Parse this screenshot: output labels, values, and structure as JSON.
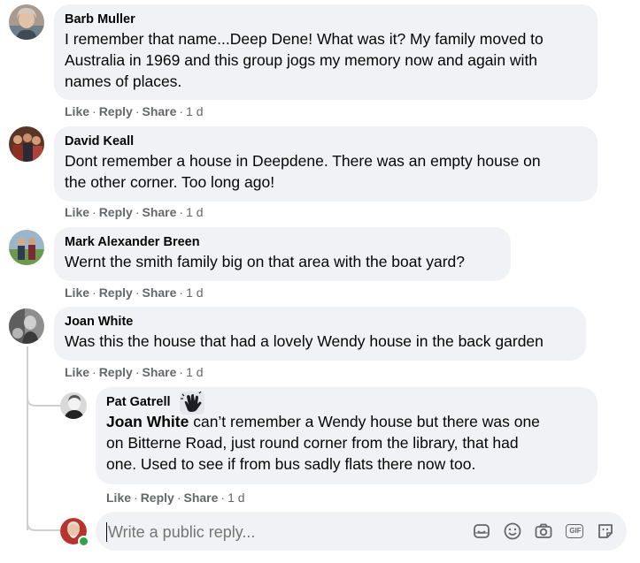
{
  "comments": [
    {
      "author": "Barb Muller",
      "lines": [
        "I remember that name...Deep Dene! What was it? My family moved to",
        "Australia in 1969 and this group jogs my memory now and again with",
        "names of places."
      ],
      "actions": {
        "like": "Like",
        "reply": "Reply",
        "share": "Share",
        "time": "1 d"
      }
    },
    {
      "author": "David Keall",
      "lines": [
        "Dont remember a house in Deepdene. There was an empty house on",
        "the other corner. Too long ago!"
      ],
      "actions": {
        "like": "Like",
        "reply": "Reply",
        "share": "Share",
        "time": "1 d"
      }
    },
    {
      "author": "Mark Alexander Breen",
      "lines": [
        "Wernt the smith family big on that area with the boat yard?"
      ],
      "actions": {
        "like": "Like",
        "reply": "Reply",
        "share": "Share",
        "time": "1 d"
      }
    },
    {
      "author": "Joan White",
      "lines": [
        "Was this the house that had a lovely Wendy house in the back garden"
      ],
      "actions": {
        "like": "Like",
        "reply": "Reply",
        "share": "Share",
        "time": "1 d"
      }
    }
  ],
  "reply": {
    "author": "Pat Gatrell",
    "mention": "Joan White",
    "first_line_rest": " can’t remember a Wendy house but there was one",
    "lines": [
      "on Bitterne Road, just round corner from the library, that had",
      "one. Used to see if from bus sadly flats there now too."
    ],
    "actions": {
      "like": "Like",
      "reply": "Reply",
      "share": "Share",
      "time": "1 d"
    }
  },
  "composer": {
    "placeholder": "Write a public reply...",
    "tools": [
      "sticker-icon",
      "emoji-icon",
      "camera-icon",
      "gif-icon",
      "avatar-sticker-icon"
    ],
    "gif_label": "GIF"
  },
  "colors": {
    "bubble": "#f0f2f5",
    "muted": "#65676b",
    "text": "#050505",
    "online": "#31a24c"
  }
}
